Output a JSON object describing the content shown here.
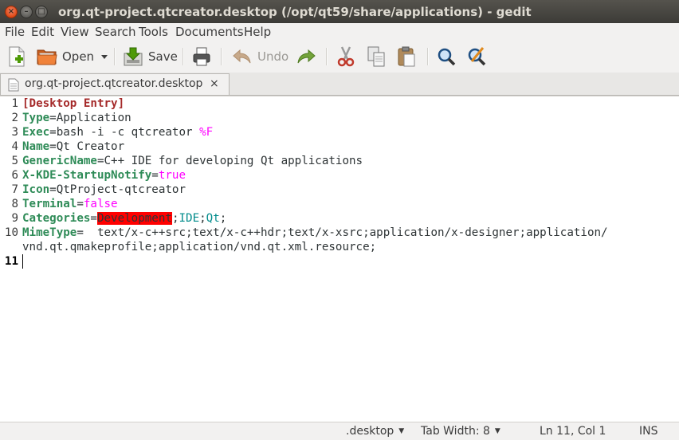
{
  "window": {
    "title": "org.qt-project.qtcreator.desktop (/opt/qt59/share/applications) - gedit",
    "buttons": {
      "close": "×",
      "minimize": "–",
      "maximize": "□"
    }
  },
  "menu": [
    "File",
    "Edit",
    "View",
    "Search",
    "Tools",
    "Documents",
    "Help"
  ],
  "toolbar": {
    "open_label": "Open",
    "save_label": "Save",
    "undo_label": "Undo",
    "icons": [
      "new-document-icon",
      "open-folder-icon",
      "dropdown-arrow-icon",
      "save-icon",
      "print-icon",
      "undo-icon",
      "redo-icon",
      "cut-icon",
      "copy-icon",
      "paste-icon",
      "search-icon",
      "search-replace-icon"
    ]
  },
  "tab": {
    "label": "org.qt-project.qtcreator.desktop",
    "close": "×"
  },
  "editor": {
    "line_numbers": [
      "1",
      "2",
      "3",
      "4",
      "5",
      "6",
      "7",
      "8",
      "9",
      "10",
      "",
      "11"
    ],
    "lines": {
      "l1": {
        "section": "[Desktop Entry]"
      },
      "l2": {
        "key": "Type",
        "eq": "=",
        "value": "Application"
      },
      "l3": {
        "key": "Exec",
        "eq": "=",
        "value": "bash -i -c qtcreator ",
        "code": "%F"
      },
      "l4": {
        "key": "Name",
        "eq": "=",
        "value": "Qt Creator"
      },
      "l5": {
        "key": "GenericName",
        "eq": "=",
        "value": "C++ IDE for developing Qt applications"
      },
      "l6": {
        "key": "X-KDE-StartupNotify",
        "eq": "=",
        "value": "true"
      },
      "l7": {
        "key": "Icon",
        "eq": "=",
        "value": "QtProject-qtcreator"
      },
      "l8": {
        "key": "Terminal",
        "eq": "=",
        "value": "false"
      },
      "l9": {
        "key": "Categories",
        "eq": "=",
        "err": "Development",
        "semi1": ";",
        "ide": "IDE",
        "semi2": ";",
        "qt": "Qt",
        "semi3": ";"
      },
      "l10": {
        "key": "MimeType",
        "eq": "=",
        "value": "  text/x-c++src;text/x-c++hdr;text/x-xsrc;application/x-designer;application/"
      },
      "l10b": {
        "value": "vnd.qt.qmakeprofile;application/vnd.qt.xml.resource;"
      }
    },
    "colors": {
      "section": "#a52a2a",
      "key": "#2e8b57",
      "boolean": "#ff00ff",
      "error_bg": "#ff0000",
      "known_category": "#008b8b"
    }
  },
  "status": {
    "language": ".desktop",
    "tab_width": "Tab Width: 8",
    "position": "Ln 11, Col 1",
    "mode": "INS"
  }
}
